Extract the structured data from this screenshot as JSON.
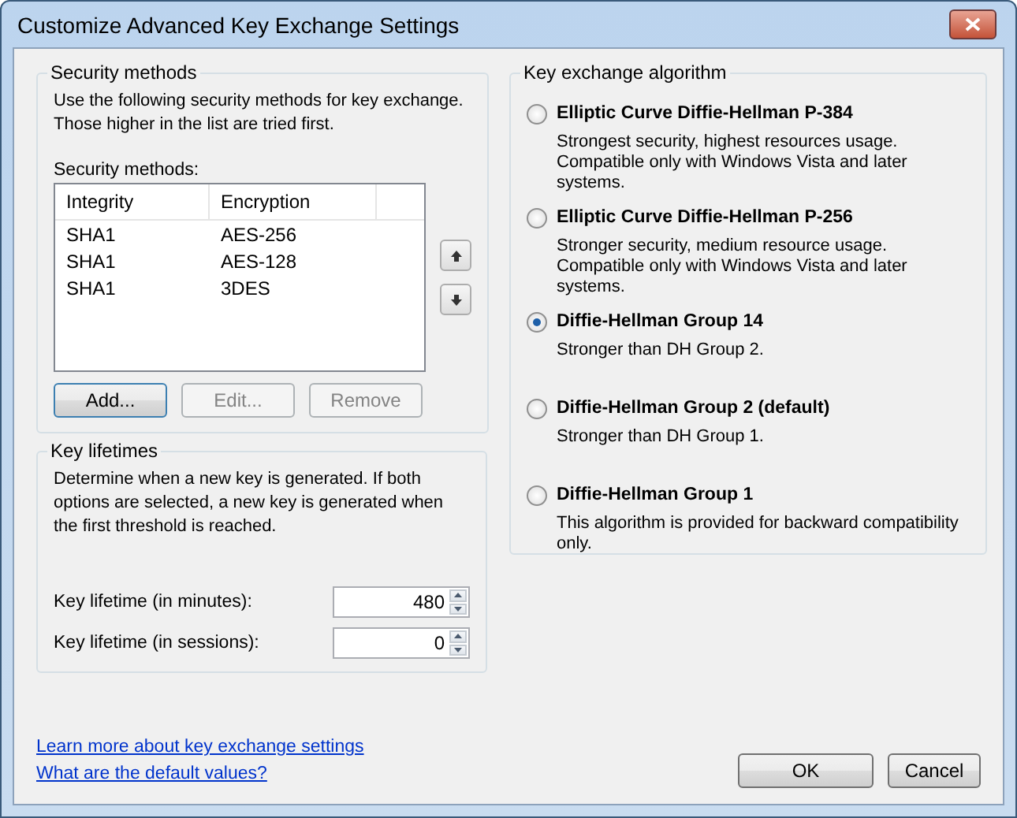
{
  "window": {
    "title": "Customize Advanced Key Exchange Settings"
  },
  "security_methods": {
    "title": "Security methods",
    "description": "Use the following security methods for key exchange. Those higher in the list are tried first.",
    "list_label": "Security methods:",
    "columns": [
      "Integrity",
      "Encryption"
    ],
    "rows": [
      {
        "integrity": "SHA1",
        "encryption": "AES-256"
      },
      {
        "integrity": "SHA1",
        "encryption": "AES-128"
      },
      {
        "integrity": "SHA1",
        "encryption": "3DES"
      }
    ],
    "buttons": [
      {
        "label": "Add...",
        "disabled": false,
        "focused": true
      },
      {
        "label": "Edit...",
        "disabled": true,
        "focused": false
      },
      {
        "label": "Remove",
        "disabled": true,
        "focused": false
      }
    ]
  },
  "key_lifetimes": {
    "title": "Key lifetimes",
    "description": "Determine when a new key is generated. If both options are selected, a new key is generated when the first threshold is reached.",
    "fields": [
      {
        "label": "Key lifetime (in minutes):",
        "value": "480"
      },
      {
        "label": "Key lifetime (in sessions):",
        "value": "0"
      }
    ]
  },
  "algorithms": {
    "title": "Key exchange algorithm",
    "options": [
      {
        "label": "Elliptic Curve Diffie-Hellman P-384",
        "description": "Strongest security, highest resources usage. Compatible only with Windows Vista and later systems.",
        "selected": false
      },
      {
        "label": "Elliptic Curve Diffie-Hellman P-256",
        "description": "Stronger security, medium resource usage. Compatible only with Windows Vista and later systems.",
        "selected": false
      },
      {
        "label": "Diffie-Hellman Group 14",
        "description": "Stronger than DH Group 2.",
        "selected": true
      },
      {
        "label": "Diffie-Hellman Group 2 (default)",
        "description": "Stronger than DH Group 1.",
        "selected": false
      },
      {
        "label": "Diffie-Hellman Group 1",
        "description": "This algorithm is provided for backward compatibility only.",
        "selected": false
      }
    ]
  },
  "links": [
    "Learn more about key exchange settings",
    "What are the default values?"
  ],
  "buttons": [
    "OK",
    "Cancel"
  ]
}
